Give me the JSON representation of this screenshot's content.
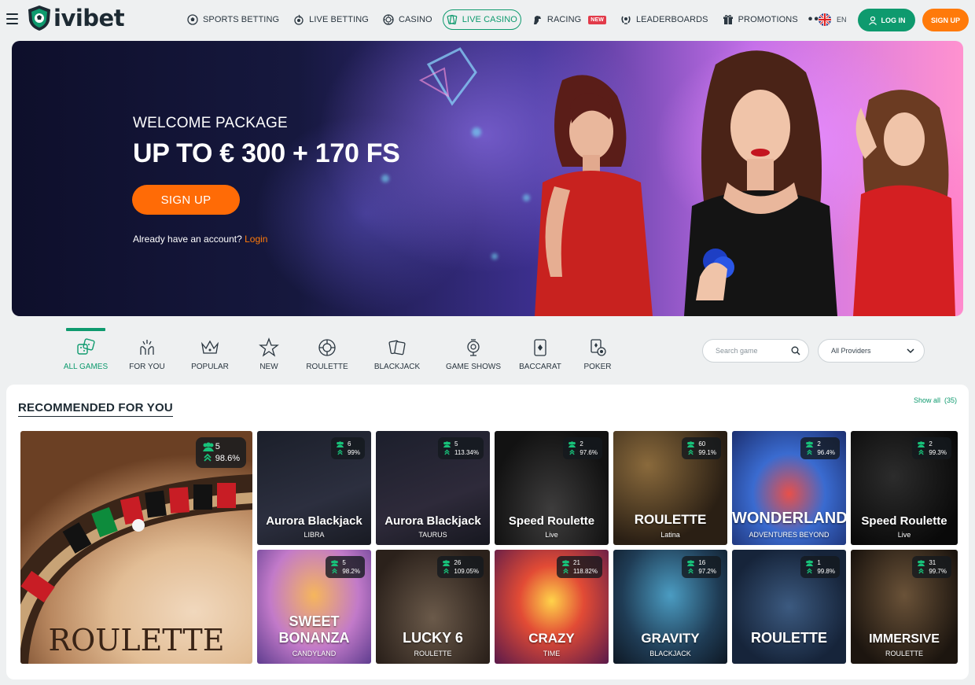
{
  "header": {
    "logo_text": "ivibet",
    "nav": [
      {
        "label": "SPORTS BETTING",
        "icon": "soccer-ball-icon"
      },
      {
        "label": "LIVE BETTING",
        "icon": "live-ball-icon"
      },
      {
        "label": "CASINO",
        "icon": "casino-chip-icon"
      },
      {
        "label": "LIVE CASINO",
        "icon": "live-cards-icon",
        "active": true
      },
      {
        "label": "RACING",
        "icon": "horse-icon",
        "badge": "NEW"
      },
      {
        "label": "LEADERBOARDS",
        "icon": "laurel-icon"
      },
      {
        "label": "PROMOTIONS",
        "icon": "gift-icon"
      }
    ],
    "more_label": "•••",
    "lang": "EN",
    "login_label": "LOG IN",
    "signup_label": "SIGN UP"
  },
  "banner": {
    "eyebrow": "WELCOME PACKAGE",
    "headline": "UP TO € 300 + 170 FS",
    "cta_label": "SIGN UP",
    "account_prompt": "Already have an account?",
    "login_link": "Login"
  },
  "categories": [
    {
      "label": "ALL GAMES",
      "icon": "dice-icon",
      "active": true
    },
    {
      "label": "FOR YOU",
      "icon": "hands-icon"
    },
    {
      "label": "POPULAR",
      "icon": "crown-icon"
    },
    {
      "label": "NEW",
      "icon": "star-icon"
    },
    {
      "label": "ROULETTE",
      "icon": "roulette-icon"
    },
    {
      "label": "BLACKJACK",
      "icon": "cards-icon"
    },
    {
      "label": "GAME SHOWS",
      "icon": "microphone-icon"
    },
    {
      "label": "BACCARAT",
      "icon": "card-icon"
    },
    {
      "label": "POKER",
      "icon": "poker-icon"
    }
  ],
  "filters": {
    "search_placeholder": "Search game",
    "providers_value": "All Providers"
  },
  "recommended": {
    "title": "RECOMMENDED FOR YOU",
    "show_all": "Show all",
    "count": "(35)",
    "featured": {
      "title": "ROULETTE",
      "players": "5",
      "rtp": "98.6%"
    },
    "games": [
      {
        "title": "Aurora Blackjack",
        "sub": "LIBRA",
        "players": "6",
        "rtp": "99%"
      },
      {
        "title": "Aurora Blackjack",
        "sub": "TAURUS",
        "players": "5",
        "rtp": "113.34%"
      },
      {
        "title": "Speed Roulette",
        "sub": "Live",
        "players": "2",
        "rtp": "97.6%"
      },
      {
        "title": "ROULETTE",
        "sub": "Latina",
        "players": "60",
        "rtp": "99.1%"
      },
      {
        "title": "WONDERLAND",
        "sub": "ADVENTURES BEYOND",
        "players": "2",
        "rtp": "96.4%"
      },
      {
        "title": "Speed Roulette",
        "sub": "Live",
        "players": "2",
        "rtp": "99.3%"
      },
      {
        "title": "SWEET BONANZA",
        "sub": "CANDYLAND",
        "players": "5",
        "rtp": "98.2%"
      },
      {
        "title": "LUCKY 6",
        "sub": "ROULETTE",
        "players": "26",
        "rtp": "109.05%"
      },
      {
        "title": "CRAZY",
        "sub": "TIME",
        "players": "21",
        "rtp": "118.82%"
      },
      {
        "title": "GRAVITY",
        "sub": "BLACKJACK",
        "players": "16",
        "rtp": "97.2%"
      },
      {
        "title": "ROULETTE",
        "sub": "",
        "players": "1",
        "rtp": "99.8%"
      },
      {
        "title": "IMMERSIVE",
        "sub": "ROULETTE",
        "players": "31",
        "rtp": "99.7%"
      }
    ]
  },
  "colors": {
    "brand_green": "#0e9a6e",
    "accent_orange": "#ff7a0a"
  }
}
